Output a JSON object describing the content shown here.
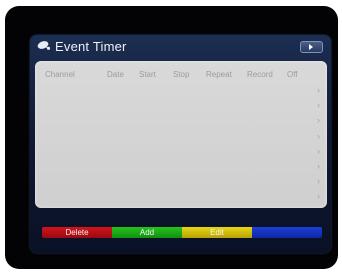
{
  "window": {
    "title": "Event Timer",
    "logo_icon": "satellite-dish-icon",
    "nav_icon": "play-arrow-icon"
  },
  "columns": [
    "Channel",
    "Date",
    "Start",
    "Stop",
    "Repeat",
    "Record",
    "Off"
  ],
  "rows": [
    {
      "chevron": "›"
    },
    {
      "chevron": "›"
    },
    {
      "chevron": "›"
    },
    {
      "chevron": "›"
    },
    {
      "chevron": "›"
    },
    {
      "chevron": "›"
    },
    {
      "chevron": "›"
    },
    {
      "chevron": "›"
    }
  ],
  "color_keys": [
    {
      "label": "Delete",
      "color": "red",
      "hex": "#c81018"
    },
    {
      "label": "Add",
      "color": "green",
      "hex": "#22b81c"
    },
    {
      "label": "Edit",
      "color": "yellow",
      "hex": "#ddc80e"
    },
    {
      "label": "",
      "color": "blue",
      "hex": "#1a3ad0"
    }
  ]
}
